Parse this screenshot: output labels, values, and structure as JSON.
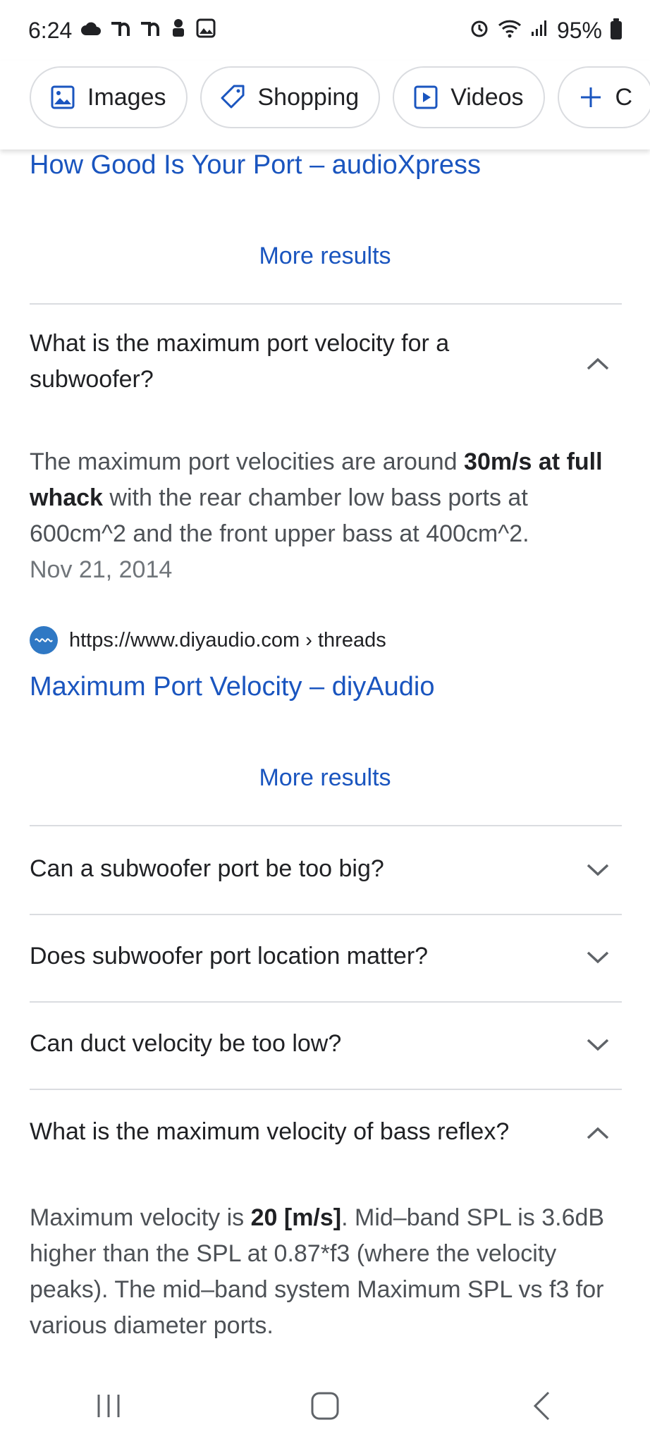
{
  "status_bar": {
    "time": "6:24",
    "battery": "95%",
    "left_icons": [
      "cloud-icon",
      "app-icon",
      "app-icon",
      "android-icon",
      "gallery-icon"
    ],
    "right_icons": [
      "alarm-icon",
      "wifi-icon",
      "signal-icon",
      "battery-icon"
    ]
  },
  "chips": [
    {
      "label": "Images",
      "icon": "image-icon"
    },
    {
      "label": "Shopping",
      "icon": "tag-icon"
    },
    {
      "label": "Videos",
      "icon": "play-icon"
    },
    {
      "label": "C",
      "icon": "plus-icon"
    }
  ],
  "result1": {
    "title": "How Good Is Your Port – audioXpress",
    "more": "More results"
  },
  "faq": {
    "q1": "What is the maximum port velocity for a subwoofer?",
    "a1_pre": "The maximum port velocities are around ",
    "a1_bold": "30m/s at full whack",
    "a1_post": " with the rear chamber low bass ports at 600cm^2 and the front upper bass at 400cm^2.",
    "a1_date": "Nov 21, 2014",
    "a1_source_url": "https://www.diyaudio.com › threads",
    "a1_link": "Maximum Port Velocity – diyAudio",
    "a1_more": "More results",
    "q2": "Can a subwoofer port be too big?",
    "q3": "Does subwoofer port location matter?",
    "q4": "Can duct velocity be too low?",
    "q5": "What is the maximum velocity of bass reflex?",
    "a5_pre": "Maximum velocity is ",
    "a5_bold": "20 [m/s]",
    "a5_post": ". Mid–band SPL is 3.6dB higher than the SPL at 0.87*f3 (where the velocity peaks). The mid–band system Maximum SPL vs f3 for various diameter ports."
  },
  "colors": {
    "link": "#1a55bf",
    "divider": "#dadce0",
    "text": "#202124"
  }
}
